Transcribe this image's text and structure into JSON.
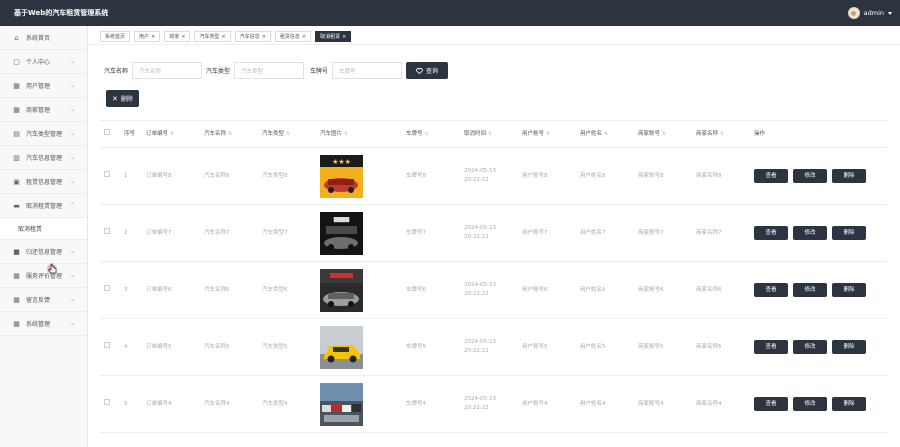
{
  "app": {
    "title": "基于Web的汽车租赁管理系统",
    "user": "admin"
  },
  "sidebar": {
    "items": [
      {
        "label": "系统首页",
        "icon": "home-icon",
        "expanded": false
      },
      {
        "label": "个人中心",
        "icon": "calendar-icon",
        "expanded": false
      },
      {
        "label": "用户管理",
        "icon": "grid-icon",
        "expanded": false
      },
      {
        "label": "商家管理",
        "icon": "grid-icon",
        "expanded": false
      },
      {
        "label": "汽车类型管理",
        "icon": "car-icon",
        "expanded": false
      },
      {
        "label": "汽车信息管理",
        "icon": "chart-icon",
        "expanded": false
      },
      {
        "label": "租赁信息管理",
        "icon": "print-icon",
        "expanded": false
      },
      {
        "label": "取消租赁管理",
        "icon": "message-icon",
        "expanded": true
      },
      {
        "label": "归还信息管理",
        "icon": "video-icon",
        "expanded": false
      },
      {
        "label": "服务评价管理",
        "icon": "grid-icon",
        "expanded": false
      },
      {
        "label": "留言反馈",
        "icon": "grid-icon",
        "expanded": false
      },
      {
        "label": "系统管理",
        "icon": "grid-icon",
        "expanded": false
      }
    ],
    "sub_item": "取消租赁"
  },
  "tabs": [
    {
      "label": "系统首页",
      "active": false,
      "closable": false
    },
    {
      "label": "用户",
      "active": false,
      "closable": true
    },
    {
      "label": "商家",
      "active": false,
      "closable": true
    },
    {
      "label": "汽车类型",
      "active": false,
      "closable": true
    },
    {
      "label": "汽车信息",
      "active": false,
      "closable": true
    },
    {
      "label": "租赁信息",
      "active": false,
      "closable": true
    },
    {
      "label": "取消租赁",
      "active": true,
      "closable": true
    }
  ],
  "tab_close": "×",
  "search": {
    "car_name_label": "汽车名称",
    "car_name_placeholder": "汽车名称",
    "car_type_label": "汽车类型",
    "car_type_placeholder": "汽车类型",
    "plate_label": "车牌号",
    "plate_placeholder": "车牌号",
    "query_label": "查询"
  },
  "delete_label": "删除",
  "table": {
    "headers": [
      "序号",
      "订单编号",
      "汽车名称",
      "汽车类型",
      "汽车图片",
      "车牌号",
      "取消时间",
      "用户账号",
      "用户姓名",
      "商家账号",
      "商家名称",
      "操作"
    ],
    "sort_mark": "⇅",
    "rows": [
      {
        "no": "1",
        "order": "订单编号8",
        "name": "汽车名称8",
        "type": "汽车类型8",
        "plate": "车牌号8",
        "time": "2024-05-13 20:22:22",
        "uacc": "用户账号8",
        "uname": "用户姓名8",
        "macc": "商家账号8",
        "mname": "商家名称8",
        "img": "poster-orange"
      },
      {
        "no": "2",
        "order": "订单编号7",
        "name": "汽车名称7",
        "type": "汽车类型7",
        "plate": "车牌号7",
        "time": "2024-05-13 20:22:22",
        "uacc": "用户账号7",
        "uname": "用户姓名7",
        "macc": "商家账号7",
        "mname": "商家名称7",
        "img": "poster-dark"
      },
      {
        "no": "3",
        "order": "订单编号6",
        "name": "汽车名称6",
        "type": "汽车类型6",
        "plate": "车牌号6",
        "time": "2024-05-13 20:22:22",
        "uacc": "用户账号6",
        "uname": "用户姓名6",
        "macc": "商家账号6",
        "mname": "商家名称6",
        "img": "poster-red"
      },
      {
        "no": "4",
        "order": "订单编号5",
        "name": "汽车名称5",
        "type": "汽车类型5",
        "plate": "车牌号5",
        "time": "2024-05-13 20:22:22",
        "uacc": "用户账号5",
        "uname": "用户姓名5",
        "macc": "商家账号5",
        "mname": "商家名称5",
        "img": "yellow-car"
      },
      {
        "no": "5",
        "order": "订单编号4",
        "name": "汽车名称4",
        "type": "汽车类型4",
        "plate": "车牌号4",
        "time": "2024-05-13 20:22:22",
        "uacc": "用户账号4",
        "uname": "用户姓名4",
        "macc": "商家账号4",
        "mname": "商家名称4",
        "img": "parking-lot"
      }
    ],
    "actions": {
      "view": "查看",
      "edit": "修改",
      "delete": "删除"
    }
  },
  "colors": {
    "topbar": "#2c3440",
    "button": "#2c3440",
    "sidebar_bg": "#f8f8f8"
  }
}
